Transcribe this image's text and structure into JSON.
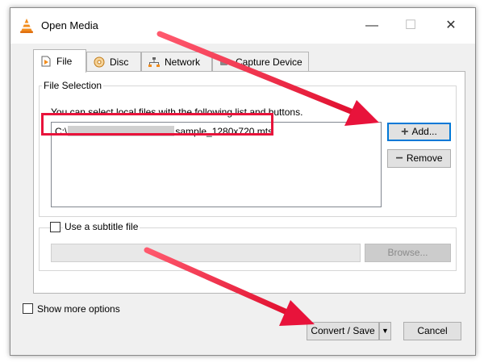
{
  "window": {
    "title": "Open Media",
    "minimize_glyph": "—",
    "maximize_glyph": "☐",
    "close_glyph": "✕"
  },
  "tabs": [
    {
      "label": "File",
      "icon": "file-icon",
      "active": true
    },
    {
      "label": "Disc",
      "icon": "disc-icon",
      "active": false
    },
    {
      "label": "Network",
      "icon": "network-icon",
      "active": false
    },
    {
      "label": "Capture Device",
      "icon": "capture-device-icon",
      "active": false
    }
  ],
  "file_selection": {
    "group_title": "File Selection",
    "info_text": "You can select local files with the following list and buttons.",
    "files": [
      {
        "prefix": "C:\\",
        "suffix": "sample_1280x720.mts"
      }
    ],
    "add_label": "Add...",
    "remove_label": "Remove"
  },
  "subtitle": {
    "checkbox_label": "Use a subtitle file",
    "browse_label": "Browse..."
  },
  "show_more_label": "Show more options",
  "footer": {
    "convert_label": "Convert / Save",
    "dropdown_glyph": "▼",
    "cancel_label": "Cancel"
  },
  "colors": {
    "annotation_red": "#e8133b",
    "focus_blue": "#0078d7",
    "vlc_orange": "#f28c1c"
  }
}
